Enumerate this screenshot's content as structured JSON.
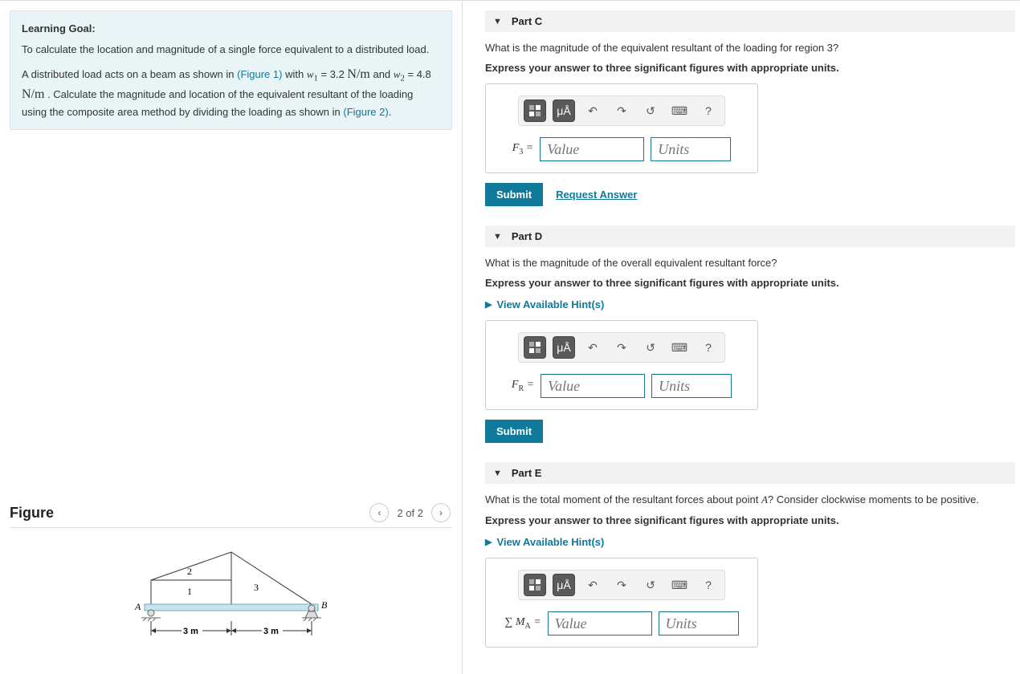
{
  "learning_goal": {
    "heading": "Learning Goal:",
    "objective": "To calculate the location and magnitude of a single force equivalent to a distributed load.",
    "text_a": "A distributed load acts on a beam as shown in ",
    "fig1_link": "(Figure 1)",
    "text_b": " with ",
    "w1": "w₁ = 3.2 N/m",
    "text_c": " and ",
    "w2": "w₂ = 4.8 N/m",
    "text_d": " . Calculate the magnitude and location of the equivalent resultant of the loading using the composite area method by dividing the loading as shown in ",
    "fig2_link": "(Figure 2)",
    "text_e": "."
  },
  "figure": {
    "title": "Figure",
    "counter": "2 of 2",
    "labels": {
      "r1": "1",
      "r2": "2",
      "r3": "3",
      "A": "A",
      "B": "B",
      "d1": "3 m",
      "d2": "3 m"
    }
  },
  "parts": {
    "c": {
      "title": "Part C",
      "question": "What is the magnitude of the equivalent resultant of the loading for region 3?",
      "instruction": "Express your answer to three significant figures with appropriate units.",
      "var_html": "F<sub>3</sub> =",
      "value_ph": "Value",
      "units_ph": "Units",
      "submit": "Submit",
      "request": "Request Answer"
    },
    "d": {
      "title": "Part D",
      "question": "What is the magnitude of the overall equivalent resultant force?",
      "instruction": "Express your answer to three significant figures with appropriate units.",
      "hints": "View Available Hint(s)",
      "var_html": "F<sub>R</sub> =",
      "value_ph": "Value",
      "units_ph": "Units",
      "submit": "Submit"
    },
    "e": {
      "title": "Part E",
      "question_a": "What is the total moment of the resultant forces about point ",
      "question_var": "A",
      "question_b": "? Consider clockwise moments to be positive.",
      "instruction": "Express your answer to three significant figures with appropriate units.",
      "hints": "View Available Hint(s)",
      "var_html": "∑ M<sub>A</sub> =",
      "value_ph": "Value",
      "units_ph": "Units"
    }
  },
  "toolbar": {
    "units_btn": "μÅ",
    "help": "?"
  },
  "chart_data": {
    "type": "diagram",
    "description": "Simply supported beam A-B, total span 6 m (3 m + 3 m). Distributed load divided into three regions: 1 = left rectangle (0–3 m, height w1=3.2 N/m), 2 = left triangle on top of region 1 (0–3 m, rising from w1 to peak w2=4.8 N/m at x=3 m), 3 = right triangle (3–6 m, decreasing from peak w2 to 0).",
    "span_segments_m": [
      3,
      3
    ],
    "w1_N_per_m": 3.2,
    "w2_N_per_m": 4.8,
    "regions": [
      {
        "id": 1,
        "shape": "rectangle",
        "x_range_m": [
          0,
          3
        ],
        "height_N_per_m": 3.2
      },
      {
        "id": 2,
        "shape": "triangle",
        "x_range_m": [
          0,
          3
        ],
        "base_N_per_m": 3.2,
        "peak_N_per_m": 4.8
      },
      {
        "id": 3,
        "shape": "triangle",
        "x_range_m": [
          3,
          6
        ],
        "peak_N_per_m": 4.8,
        "end_N_per_m": 0
      }
    ]
  }
}
